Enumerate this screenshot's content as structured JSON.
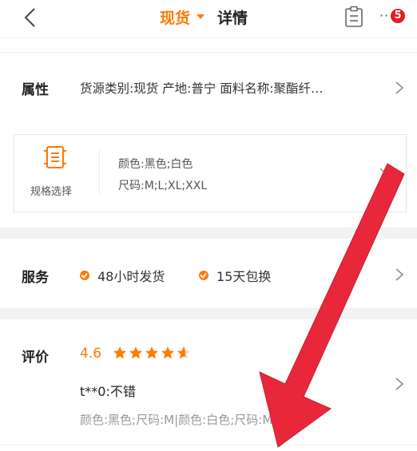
{
  "nav": {
    "active_tab": "现货",
    "tab_detail": "详情",
    "badge_count": "5",
    "more_dots": "··"
  },
  "attributes": {
    "label": "属性",
    "text": "货源类别:现货  产地:普宁  面料名称:聚酯纤…"
  },
  "spec": {
    "caption": "规格选择",
    "color_line": "颜色:黑色;白色",
    "size_line": "尺码:M;L;XL;XXL"
  },
  "service": {
    "label": "服务",
    "items": [
      "48小时发货",
      "15天包换"
    ]
  },
  "review": {
    "label": "评价",
    "score": "4.6",
    "rating": 4.6,
    "text": "t**0:不错",
    "spec": "颜色:黑色;尺码:M|颜色:白色;尺码:M"
  },
  "colors": {
    "accent": "#ff7a00",
    "badge": "#e51c23",
    "arrow": "#e8283a"
  },
  "icons": [
    "back-chevron-icon",
    "clipboard-icon",
    "more-icon",
    "spec-list-icon",
    "chevron-right-icon",
    "check-icon",
    "star-icon"
  ]
}
